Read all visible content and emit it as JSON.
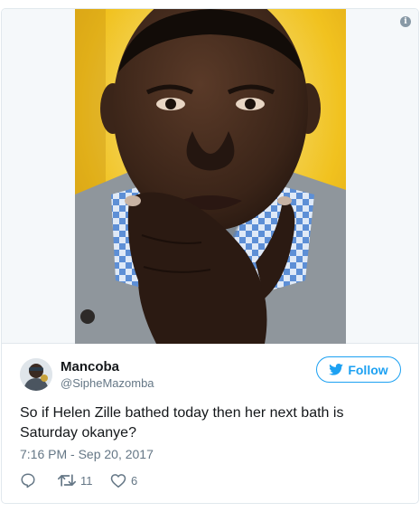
{
  "tweet": {
    "display_name": "Mancoba",
    "handle": "@SipheMazomba",
    "follow_label": "Follow",
    "text": "So if Helen Zille bathed today then her next bath is Saturday okanye?",
    "timestamp": "7:16 PM - Sep 20, 2017",
    "retweet_count": "11",
    "like_count": "6"
  },
  "icons": {
    "info": "info-icon",
    "follow_bird": "twitter-bird-icon",
    "reply": "reply-icon",
    "retweet": "retweet-icon",
    "like": "heart-icon"
  },
  "colors": {
    "accent": "#1da1f2",
    "muted": "#657786",
    "border": "#e1e8ed"
  }
}
